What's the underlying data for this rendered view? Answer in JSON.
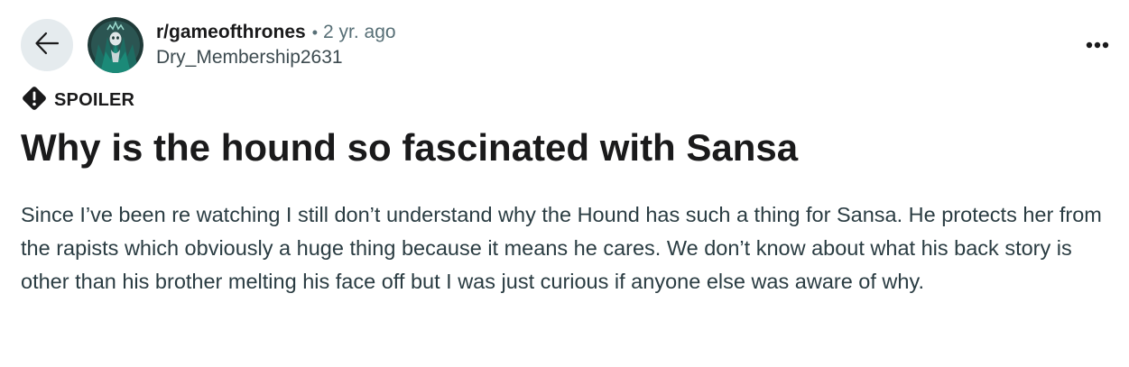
{
  "post": {
    "subreddit": "r/gameofthrones",
    "separator": "•",
    "age": "2 yr. ago",
    "author": "Dry_Membership2631",
    "spoiler_label": "SPOILER",
    "title": "Why is the hound so fascinated with Sansa",
    "body": "Since I’ve been re watching I still don’t understand why the Hound has such a thing for Sansa. He protects her from the rapists which obviously a huge thing because it means he cares. We don’t know about what his back story is other than his brother melting his face off but I was just curious if anyone else was aware of why."
  },
  "icons": {
    "back": "back-arrow-icon",
    "more": "more-options-icon",
    "spoiler": "warning-icon",
    "avatar": "subreddit-avatar-icon"
  },
  "colors": {
    "back_button_bg": "#e5ebee",
    "meta_gray": "#576f76",
    "body_text": "#2a3c42",
    "title_text": "#1a1a1b"
  }
}
